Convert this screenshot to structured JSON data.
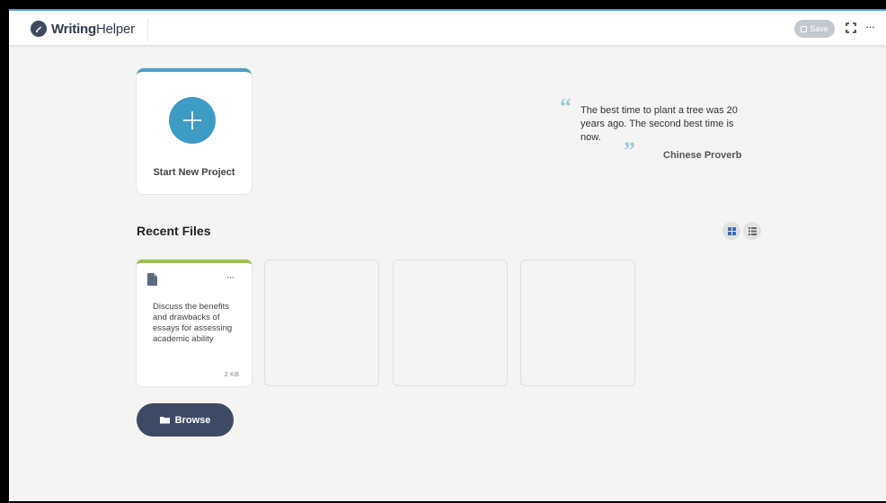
{
  "header": {
    "logo_bold": "Writing",
    "logo_light": "Helper",
    "save_label": "Save",
    "expand_icon": "expand-icon",
    "more_label": "···"
  },
  "new_project": {
    "label": "Start New Project",
    "icon": "plus-icon"
  },
  "quote": {
    "text": "The best time to plant a tree was 20 years ago. The second best time is now.",
    "author": "Chinese Proverb"
  },
  "recent": {
    "title": "Recent Files",
    "files": [
      {
        "title": "Discuss the benefits and drawbacks of essays for assessing academic ability",
        "size": "2 KB",
        "more": "···"
      }
    ]
  },
  "browse": {
    "label": "Browse"
  },
  "colors": {
    "accent": "#4aa0c6",
    "file_accent": "#9cc34a",
    "button_dark": "#3e4a64"
  }
}
